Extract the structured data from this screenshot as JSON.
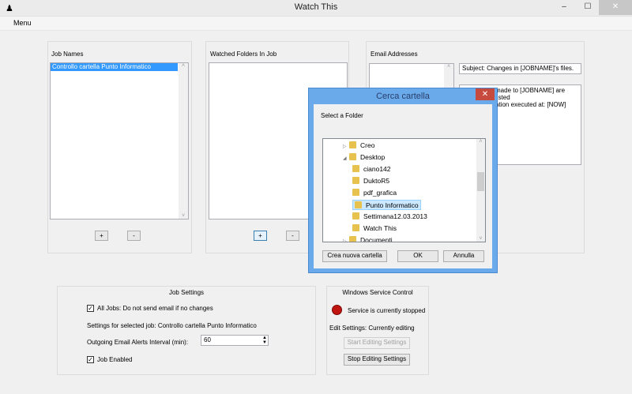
{
  "window": {
    "title": "Watch This",
    "minimize": "–",
    "maximize": "☐",
    "close": "✕"
  },
  "menu": {
    "label": "Menu"
  },
  "job_names": {
    "title": "Job Names",
    "items": [
      "Controllo cartella Punto Informatico"
    ],
    "add": "+",
    "remove": "-"
  },
  "watched_folders": {
    "title": "Watched Folders In Job",
    "add": "+",
    "remove": "-"
  },
  "email": {
    "title": "Email Addresses",
    "subject": "Subject: Changes in [JOBNAME]'s files.",
    "body_lines": [
      "made to [JOBNAME] are listed",
      "ation executed at: [NOW]"
    ]
  },
  "dialog": {
    "title": "Cerca cartella",
    "close": "✕",
    "prompt": "Select a Folder",
    "tree": [
      {
        "label": "Creo",
        "level": 1,
        "arrow": "▷"
      },
      {
        "label": "Desktop",
        "level": 1,
        "arrow": "◢"
      },
      {
        "label": "ciano142",
        "level": 2
      },
      {
        "label": "DuktoR5",
        "level": 2
      },
      {
        "label": "pdf_grafica",
        "level": 2
      },
      {
        "label": "Punto Informatico",
        "level": 2,
        "selected": true
      },
      {
        "label": "Settimana12.03.2013",
        "level": 2
      },
      {
        "label": "Watch This",
        "level": 2
      },
      {
        "label": "Documenti",
        "level": 1,
        "arrow": "▷"
      }
    ],
    "new_folder": "Crea nuova cartella",
    "ok": "OK",
    "cancel": "Annulla"
  },
  "job_settings": {
    "title": "Job Settings",
    "all_jobs_checkbox": "All Jobs: Do not send email if no changes",
    "all_jobs_checked": true,
    "selected_job": "Settings for selected job: Controllo cartella Punto Informatico",
    "interval_label": "Outgoing Email Alerts Interval (min):",
    "interval_value": "60",
    "job_enabled": "Job Enabled",
    "job_enabled_checked": true
  },
  "service": {
    "title": "Windows Service Control",
    "status": "Service is currently stopped",
    "status_color": "#c0140f",
    "edit_status": "Edit Settings: Currently editing",
    "start_btn": "Start Editing Settings",
    "stop_btn": "Stop Editing Settings"
  }
}
